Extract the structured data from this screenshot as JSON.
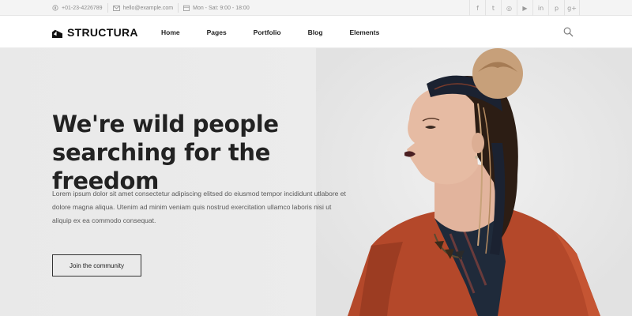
{
  "topbar": {
    "phone": "+01-23-4226789",
    "email": "hello@example.com",
    "hours": "Mon - Sat: 9:00 - 18:00",
    "social": [
      {
        "icon": "facebook-icon",
        "glyph": "f"
      },
      {
        "icon": "twitter-icon",
        "glyph": "t"
      },
      {
        "icon": "instagram-icon",
        "glyph": "◎"
      },
      {
        "icon": "youtube-icon",
        "glyph": "▶"
      },
      {
        "icon": "linkedin-icon",
        "glyph": "in"
      },
      {
        "icon": "pinterest-icon",
        "glyph": "p"
      },
      {
        "icon": "google-plus-icon",
        "glyph": "g+"
      }
    ]
  },
  "header": {
    "logo": "STRUCTURA",
    "nav": [
      "Home",
      "Pages",
      "Portfolio",
      "Blog",
      "Elements"
    ]
  },
  "hero": {
    "title_line1": "We're wild people",
    "title_line2": "searching for the freedom",
    "body": "Lorem ipsum dolor sit amet consectetur adipiscing elitsed do eiusmod tempor incididunt utlabore et dolore magna aliqua. Utenim ad minim veniam quis nostrud exercitation ullamco laboris nisi ut aliquip ex ea commodo consequat.",
    "cta": "Join the community"
  },
  "colors": {
    "text": "#222222",
    "muted": "#8a8a8a",
    "hero_bg": "#ebebeb",
    "rust": "#b4482a"
  }
}
